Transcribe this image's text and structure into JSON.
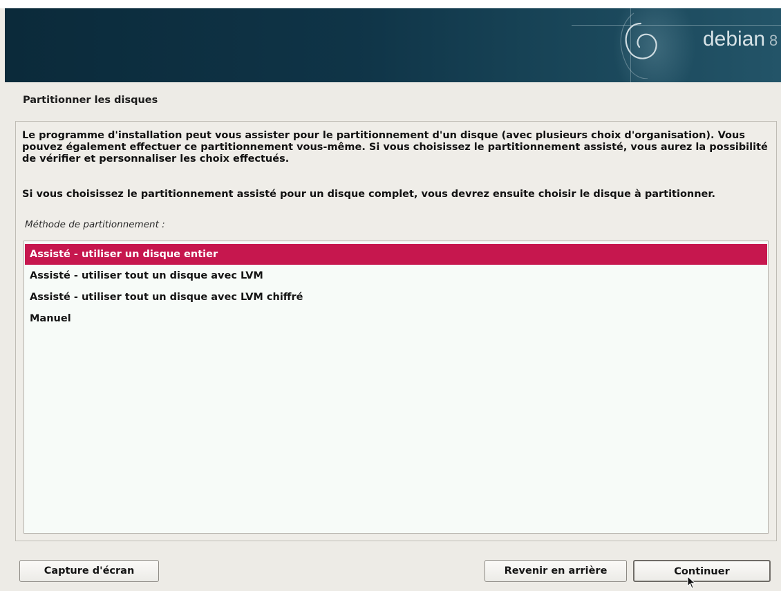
{
  "banner": {
    "brand": "debian",
    "version": "8",
    "logo_icon": "debian-swirl-icon"
  },
  "page": {
    "title": "Partitionner les disques",
    "description_1": "Le programme d'installation peut vous assister pour le partitionnement d'un disque (avec plusieurs choix d'organisation). Vous pouvez également effectuer ce partitionnement vous-même. Si vous choisissez le partitionnement assisté, vous aurez la possibilité de vérifier et personnaliser les choix effectués.",
    "description_2": "Si vous choisissez le partitionnement assisté pour un disque complet, vous devrez ensuite choisir le disque à partitionner.",
    "prompt": "Méthode de partitionnement :"
  },
  "options": [
    {
      "label": "Assisté - utiliser un disque entier",
      "selected": true
    },
    {
      "label": "Assisté - utiliser tout un disque avec LVM",
      "selected": false
    },
    {
      "label": "Assisté - utiliser tout un disque avec LVM chiffré",
      "selected": false
    },
    {
      "label": "Manuel",
      "selected": false
    }
  ],
  "buttons": {
    "screenshot": "Capture d'écran",
    "back": "Revenir en arrière",
    "continue": "Continuer"
  },
  "colors": {
    "banner_dark": "#0b2a3a",
    "selection": "#c6174e",
    "background": "#edebe6"
  }
}
